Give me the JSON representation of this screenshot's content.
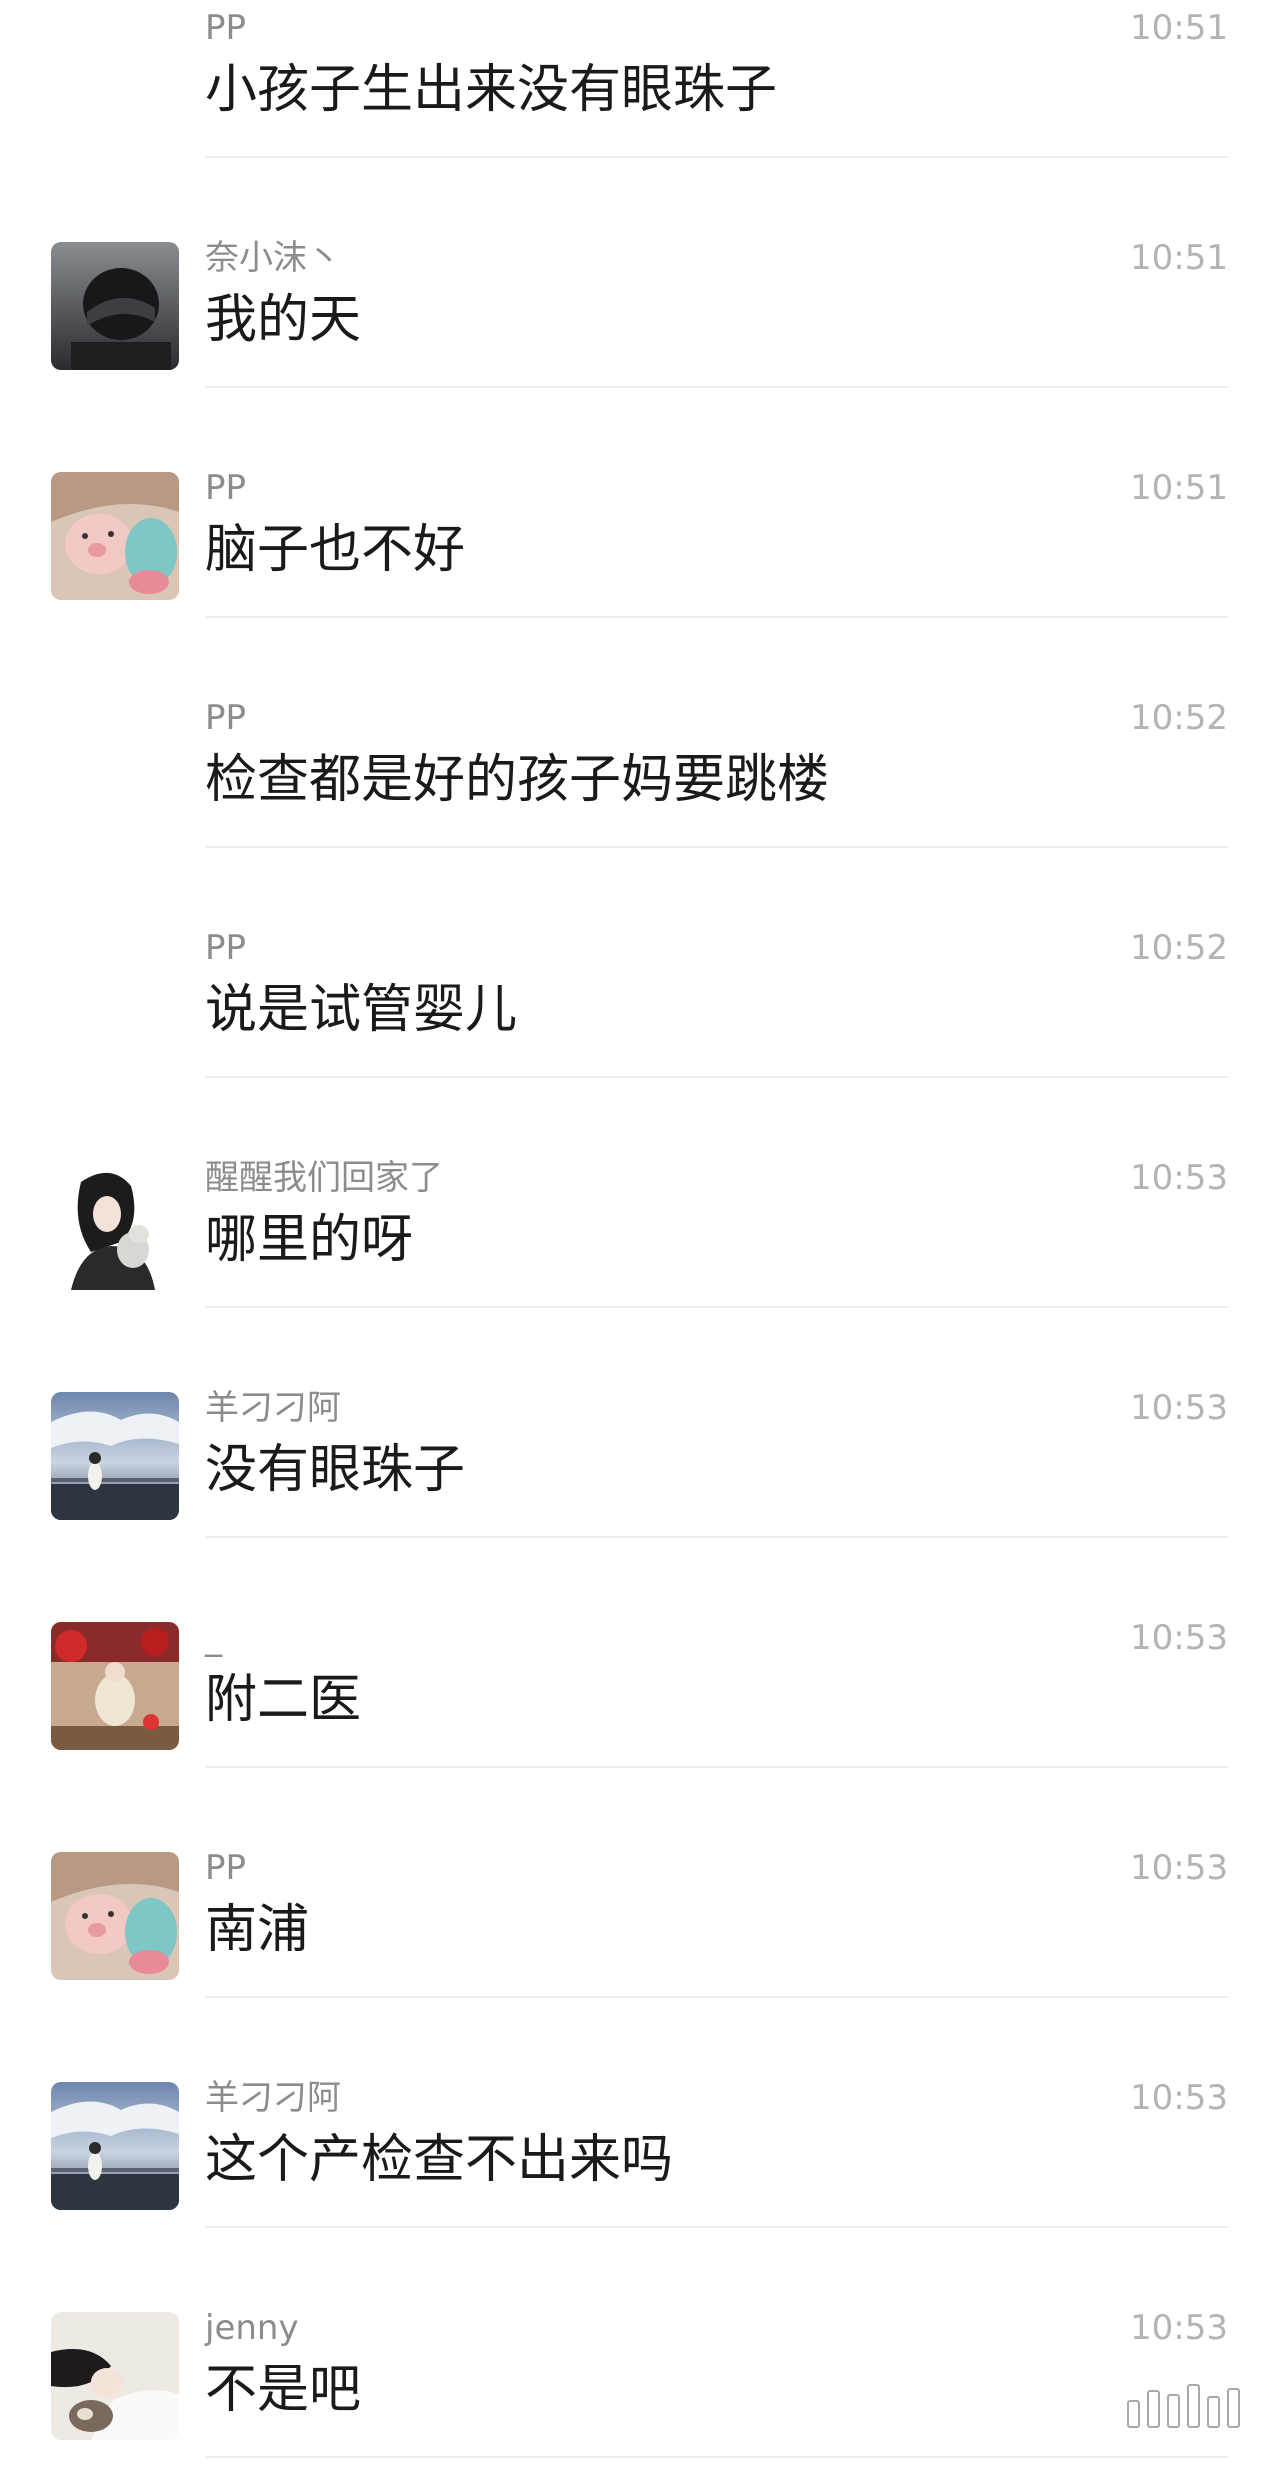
{
  "messages": [
    {
      "sender": "PP",
      "time": "10:51",
      "text": "小孩子生出来没有眼珠子",
      "avatar": "none"
    },
    {
      "sender": "奈小沫丶",
      "time": "10:51",
      "text": "我的天",
      "avatar": "helmet"
    },
    {
      "sender": "PP",
      "time": "10:51",
      "text": "脑子也不好",
      "avatar": "pig-plush"
    },
    {
      "sender": "PP",
      "time": "10:52",
      "text": "检查都是好的孩子妈要跳楼",
      "avatar": "none"
    },
    {
      "sender": "PP",
      "time": "10:52",
      "text": "说是试管婴儿",
      "avatar": "none"
    },
    {
      "sender": "醒醒我们回家了",
      "time": "10:53",
      "text": "哪里的呀",
      "avatar": "girl-cat"
    },
    {
      "sender": "羊刁刁阿",
      "time": "10:53",
      "text": "没有眼珠子",
      "avatar": "seaside"
    },
    {
      "sender": "_",
      "time": "10:53",
      "text": "附二医",
      "avatar": "red-scene"
    },
    {
      "sender": "PP",
      "time": "10:53",
      "text": "南浦",
      "avatar": "pig-plush"
    },
    {
      "sender": "羊刁刁阿",
      "time": "10:53",
      "text": "这个产检查不出来吗",
      "avatar": "seaside"
    },
    {
      "sender": "jenny",
      "time": "10:53",
      "text": "不是吧",
      "avatar": "girl-lying"
    }
  ],
  "watermark_icon": "bars-icon",
  "colors": {
    "background": "#ffffff",
    "sender": "#8c8c8c",
    "time": "#b3b3b3",
    "text": "#1a1a1a",
    "divider": "#ececec"
  }
}
